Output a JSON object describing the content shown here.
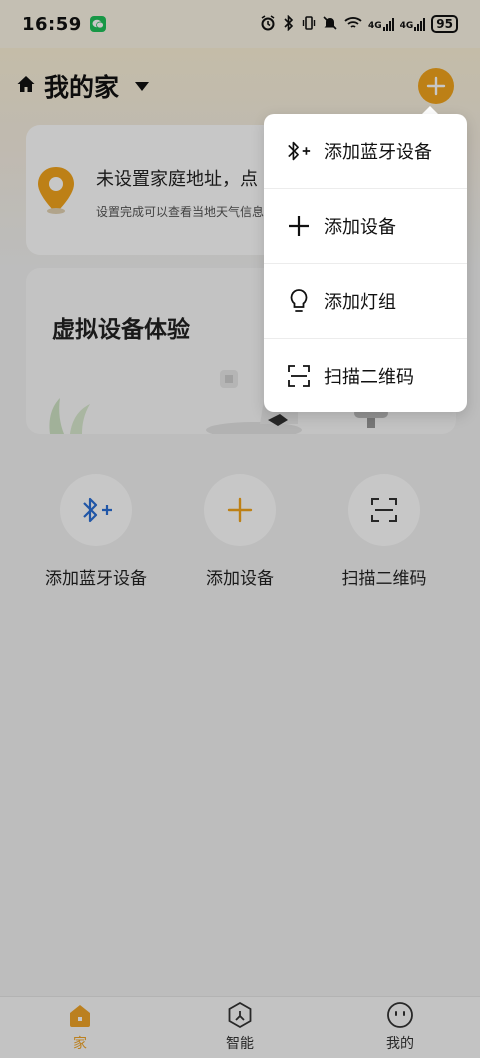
{
  "status_bar": {
    "time": "16:59",
    "network_1": "4G",
    "network_2": "4G",
    "battery": "95"
  },
  "header": {
    "title": "我的家"
  },
  "address_card": {
    "title": "未设置家庭地址，点",
    "subtitle": "设置完成可以查看当地天气信息"
  },
  "virtual_card": {
    "title": "虚拟设备体验"
  },
  "quick_actions": [
    {
      "label": "添加蓝牙设备",
      "icon": "bluetooth-plus-icon"
    },
    {
      "label": "添加设备",
      "icon": "plus-icon"
    },
    {
      "label": "扫描二维码",
      "icon": "scan-icon"
    }
  ],
  "popup_menu": {
    "items": [
      {
        "label": "添加蓝牙设备",
        "icon": "bluetooth-plus-icon"
      },
      {
        "label": "添加设备",
        "icon": "plus-icon"
      },
      {
        "label": "添加灯组",
        "icon": "bulb-icon"
      },
      {
        "label": "扫描二维码",
        "icon": "scan-icon"
      }
    ]
  },
  "bottom_nav": {
    "items": [
      {
        "label": "家",
        "icon": "home-icon",
        "active": true
      },
      {
        "label": "智能",
        "icon": "smart-icon",
        "active": false
      },
      {
        "label": "我的",
        "icon": "profile-icon",
        "active": false
      }
    ]
  },
  "colors": {
    "accent": "#f3a51d",
    "bluetooth": "#2a6fd6",
    "nav_active": "#f0a428"
  }
}
